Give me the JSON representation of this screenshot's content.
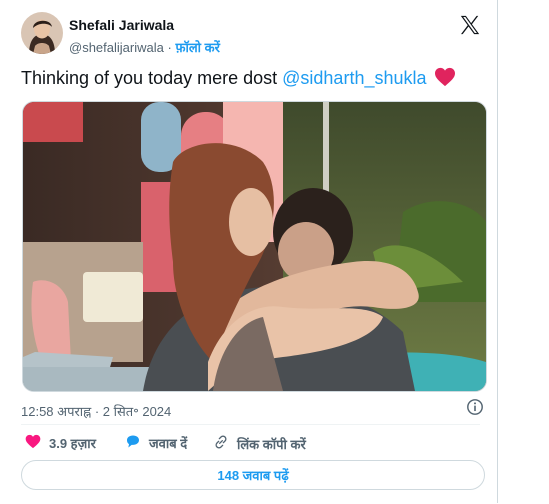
{
  "author": {
    "name": "Shefali Jariwala",
    "handle": "@shefalijariwala",
    "separator": "·",
    "follow_label": "फ़ॉलो करें"
  },
  "tweet": {
    "text_before": "Thinking of you today mere dost ",
    "mention": "@sidharth_shukla",
    "emoji": "red-heart"
  },
  "media": {
    "description_icon": "photo"
  },
  "meta": {
    "timestamp": "12:58 अपराह्न · 2 सित॰ 2024"
  },
  "actions": {
    "likes": "3.9 हज़ार",
    "reply_label": "जवाब दें",
    "copy_link_label": "लिंक कॉपी करें"
  },
  "replies_button": "148 जवाब पढ़ें",
  "colors": {
    "accent": "#1d9bf0",
    "like": "#f91880",
    "text": "#0f1419",
    "muted": "#536471",
    "border": "#cfd9de"
  }
}
